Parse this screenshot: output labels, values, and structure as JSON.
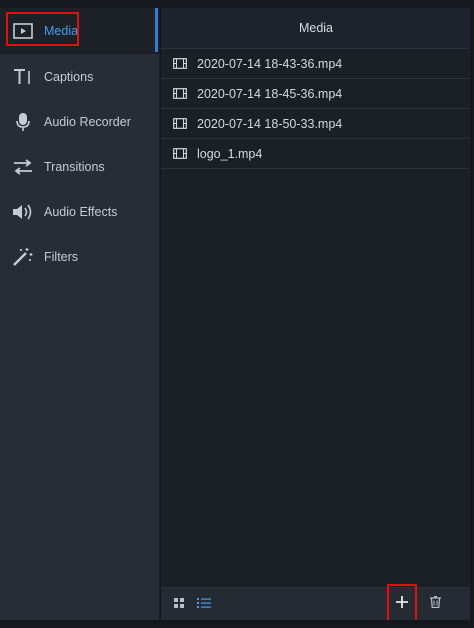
{
  "sidebar": {
    "items": [
      {
        "label": "Media",
        "icon": "play-box-icon",
        "active": true
      },
      {
        "label": "Captions",
        "icon": "text-t-icon",
        "active": false
      },
      {
        "label": "Audio Recorder",
        "icon": "microphone-icon",
        "active": false
      },
      {
        "label": "Transitions",
        "icon": "swap-arrows-icon",
        "active": false
      },
      {
        "label": "Audio Effects",
        "icon": "speaker-icon",
        "active": false
      },
      {
        "label": "Filters",
        "icon": "magic-wand-icon",
        "active": false
      }
    ]
  },
  "panel": {
    "title": "Media",
    "files": [
      {
        "name": "2020-07-14 18-43-36.mp4",
        "icon": "film-icon"
      },
      {
        "name": "2020-07-14 18-45-36.mp4",
        "icon": "film-icon"
      },
      {
        "name": "2020-07-14 18-50-33.mp4",
        "icon": "film-icon"
      },
      {
        "name": "logo_1.mp4",
        "icon": "film-icon"
      }
    ],
    "footer": {
      "grid_view": "grid-view-icon",
      "list_view": "list-view-icon",
      "add": "plus-icon",
      "delete": "trash-icon"
    }
  },
  "colors": {
    "accent": "#4a9cf0",
    "highlight": "#e01010",
    "sidebar_bg": "#262d35",
    "panel_bg": "#1b2027"
  }
}
